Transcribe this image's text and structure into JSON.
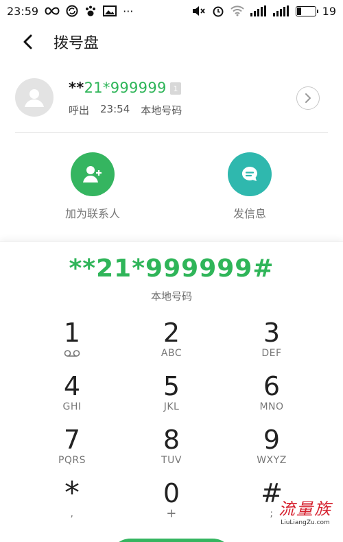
{
  "status_bar": {
    "time": "23:59",
    "dots": "···",
    "battery_level": "19",
    "icons": [
      "infinity-icon",
      "sync-icon",
      "paw-icon",
      "image-icon",
      "mute-icon",
      "alarm-icon",
      "wifi-icon",
      "signal-icon",
      "signal-icon",
      "battery-icon"
    ]
  },
  "header": {
    "title": "拨号盘"
  },
  "recent_call": {
    "number_stars": "**",
    "number_digits": "21*999999",
    "sim_label": "1",
    "direction": "呼出",
    "time": "23:54",
    "location": "本地号码"
  },
  "actions": {
    "add_contact": "加为联系人",
    "send_message": "发信息"
  },
  "dialer": {
    "number": "**21*999999#",
    "location": "本地号码",
    "keys": [
      {
        "digit": "1",
        "letters": ""
      },
      {
        "digit": "2",
        "letters": "ABC"
      },
      {
        "digit": "3",
        "letters": "DEF"
      },
      {
        "digit": "4",
        "letters": "GHI"
      },
      {
        "digit": "5",
        "letters": "JKL"
      },
      {
        "digit": "6",
        "letters": "MNO"
      },
      {
        "digit": "7",
        "letters": "PQRS"
      },
      {
        "digit": "8",
        "letters": "TUV"
      },
      {
        "digit": "9",
        "letters": "WXYZ"
      },
      {
        "digit": "*",
        "letters": ","
      },
      {
        "digit": "0",
        "letters": "+"
      },
      {
        "digit": "#",
        "letters": ";"
      }
    ]
  },
  "watermark": {
    "main": "流量族",
    "sub": "LiuLiangZu.com"
  },
  "colors": {
    "accent_green": "#35b560",
    "number_green": "#2fb559",
    "teal": "#2fb8ae"
  }
}
